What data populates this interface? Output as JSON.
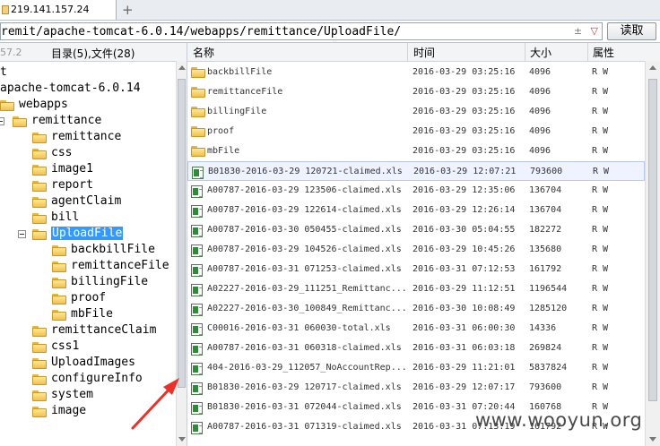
{
  "tab": {
    "label": "219.141.157.24",
    "add_label": "+"
  },
  "pathbar": {
    "path": "remit/apache-tomcat-6.0.14/webapps/remittance/UploadFile/",
    "plusminus": "±",
    "dropdown": "▽",
    "go_label": "读取"
  },
  "left_header": {
    "ip_fragment": "57.2",
    "count_label": "目录(5),文件(28)"
  },
  "tree": [
    {
      "label": "t",
      "x": 0,
      "y": 0,
      "icon": false,
      "expander": false
    },
    {
      "label": "apache-tomcat-6.0.14",
      "x": 0,
      "y": 1,
      "icon": false,
      "expander": false
    },
    {
      "label": "webapps",
      "x": 0,
      "y": 2,
      "icon": true,
      "expander": false
    },
    {
      "label": "remittance",
      "x": 1,
      "y": 3,
      "icon": true,
      "expander": true
    },
    {
      "label": "remittance",
      "x": 2,
      "y": 4,
      "icon": true,
      "expander": false
    },
    {
      "label": "css",
      "x": 2,
      "y": 5,
      "icon": true,
      "expander": false
    },
    {
      "label": "image1",
      "x": 2,
      "y": 6,
      "icon": true,
      "expander": false
    },
    {
      "label": "report",
      "x": 2,
      "y": 7,
      "icon": true,
      "expander": false
    },
    {
      "label": "agentClaim",
      "x": 2,
      "y": 8,
      "icon": true,
      "expander": false
    },
    {
      "label": "bill",
      "x": 2,
      "y": 9,
      "icon": true,
      "expander": false
    },
    {
      "label": "UploadFile",
      "x": 2,
      "y": 10,
      "icon": true,
      "expander": true,
      "selected": true
    },
    {
      "label": "backbillFile",
      "x": 3,
      "y": 11,
      "icon": true,
      "expander": false
    },
    {
      "label": "remittanceFile",
      "x": 3,
      "y": 12,
      "icon": true,
      "expander": false
    },
    {
      "label": "billingFile",
      "x": 3,
      "y": 13,
      "icon": true,
      "expander": false
    },
    {
      "label": "proof",
      "x": 3,
      "y": 14,
      "icon": true,
      "expander": false
    },
    {
      "label": "mbFile",
      "x": 3,
      "y": 15,
      "icon": true,
      "expander": false
    },
    {
      "label": "remittanceClaim",
      "x": 2,
      "y": 16,
      "icon": true,
      "expander": false
    },
    {
      "label": "css1",
      "x": 2,
      "y": 17,
      "icon": true,
      "expander": false
    },
    {
      "label": "UploadImages",
      "x": 2,
      "y": 18,
      "icon": true,
      "expander": false
    },
    {
      "label": "configureInfo",
      "x": 2,
      "y": 19,
      "icon": true,
      "expander": false
    },
    {
      "label": "system",
      "x": 2,
      "y": 20,
      "icon": true,
      "expander": false
    },
    {
      "label": "image",
      "x": 2,
      "y": 21,
      "icon": true,
      "expander": false
    }
  ],
  "columns": {
    "name": "名称",
    "time": "时间",
    "size": "大小",
    "attr": "属性"
  },
  "files": [
    {
      "type": "folder",
      "name": "backbillFile",
      "time": "2016-03-29 03:25:16",
      "size": "4096",
      "attr": "R W"
    },
    {
      "type": "folder",
      "name": "remittanceFile",
      "time": "2016-03-29 03:25:16",
      "size": "4096",
      "attr": "R W"
    },
    {
      "type": "folder",
      "name": "billingFile",
      "time": "2016-03-29 03:25:16",
      "size": "4096",
      "attr": "R W"
    },
    {
      "type": "folder",
      "name": "proof",
      "time": "2016-03-29 03:25:16",
      "size": "4096",
      "attr": "R W"
    },
    {
      "type": "folder",
      "name": "mbFile",
      "time": "2016-03-29 03:25:16",
      "size": "4096",
      "attr": "R W"
    },
    {
      "type": "xls",
      "name": "B01830-2016-03-29 120721-claimed.xls",
      "time": "2016-03-29 12:07:21",
      "size": "793600",
      "attr": "R W",
      "highlight": true
    },
    {
      "type": "xls",
      "name": "A00787-2016-03-29 123506-claimed.xls",
      "time": "2016-03-29 12:35:06",
      "size": "136704",
      "attr": "R W"
    },
    {
      "type": "xls",
      "name": "A00787-2016-03-29 122614-claimed.xls",
      "time": "2016-03-29 12:26:14",
      "size": "136704",
      "attr": "R W"
    },
    {
      "type": "xls",
      "name": "A00787-2016-03-30 050455-claimed.xls",
      "time": "2016-03-30 05:04:55",
      "size": "182272",
      "attr": "R W"
    },
    {
      "type": "xls",
      "name": "A00787-2016-03-29 104526-claimed.xls",
      "time": "2016-03-29 10:45:26",
      "size": "135680",
      "attr": "R W"
    },
    {
      "type": "xls",
      "name": "A00787-2016-03-31 071253-claimed.xls",
      "time": "2016-03-31 07:12:53",
      "size": "161792",
      "attr": "R W"
    },
    {
      "type": "xls",
      "name": "A02227-2016-03-29_111251_Remittanc...",
      "time": "2016-03-29 11:12:51",
      "size": "1196544",
      "attr": "R W"
    },
    {
      "type": "xls",
      "name": "A02227-2016-03-30_100849_Remittanc...",
      "time": "2016-03-30 10:08:49",
      "size": "1285120",
      "attr": "R W"
    },
    {
      "type": "xls",
      "name": "C00016-2016-03-31 060030-total.xls",
      "time": "2016-03-31 06:00:30",
      "size": "14336",
      "attr": "R W"
    },
    {
      "type": "xls",
      "name": "A00787-2016-03-31 060318-claimed.xls",
      "time": "2016-03-31 06:03:18",
      "size": "269824",
      "attr": "R W"
    },
    {
      "type": "xls",
      "name": "404-2016-03-29_112057_NoAccountRep...",
      "time": "2016-03-29 11:21:01",
      "size": "5837824",
      "attr": "R W"
    },
    {
      "type": "xls",
      "name": "B01830-2016-03-29 120717-claimed.xls",
      "time": "2016-03-29 12:07:17",
      "size": "793600",
      "attr": "R W"
    },
    {
      "type": "xls",
      "name": "B01830-2016-03-31 072044-claimed.xls",
      "time": "2016-03-31 07:20:44",
      "size": "160768",
      "attr": "R W"
    },
    {
      "type": "xls",
      "name": "A00787-2016-03-31 071319-claimed.xls",
      "time": "2016-03-31 07:13:19",
      "size": "161792",
      "attr": "R W"
    }
  ],
  "watermark": "www.wooyun.org",
  "colors": {
    "selection": "#3399ff",
    "arrow": "#e8322a",
    "highlight_row": "#eef3ff"
  }
}
